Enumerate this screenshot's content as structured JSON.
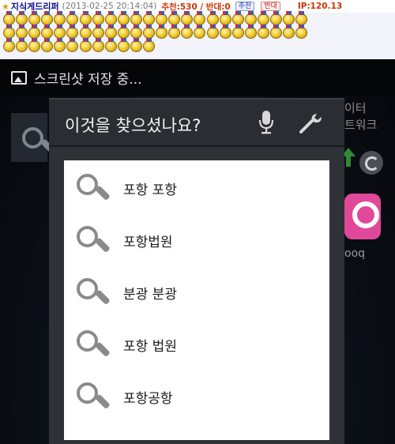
{
  "forum": {
    "star": "★",
    "author": "지식게드리퍼",
    "date": "(2013-02-25 20:14:04)",
    "votes": "추천:530 / 반대:0",
    "recommend_btn": "추천",
    "oppose_btn": "반대",
    "ip": "IP:120.13",
    "medal_rows": [
      24,
      24,
      12
    ]
  },
  "status_bar": {
    "icon": "image-icon",
    "text": "스크린샷 저장 중..."
  },
  "background": {
    "right_text_line1": "이터",
    "right_text_line2": "트워크",
    "app_label": "ooq",
    "app_color": "#e0499a"
  },
  "dialog": {
    "title": "이것을 찾으셨나요?",
    "mic_icon": "microphone-icon",
    "settings_icon": "wrench-icon",
    "suggestions": [
      {
        "label": "포항 포항"
      },
      {
        "label": "포항법원"
      },
      {
        "label": "분광 분광"
      },
      {
        "label": "포항 법원"
      },
      {
        "label": "포항공항"
      }
    ]
  },
  "colors": {
    "dialog_bg": "#2e3136",
    "list_bg": "#ffffff",
    "author": "#0a0a8a",
    "votes": "#cc3300"
  }
}
